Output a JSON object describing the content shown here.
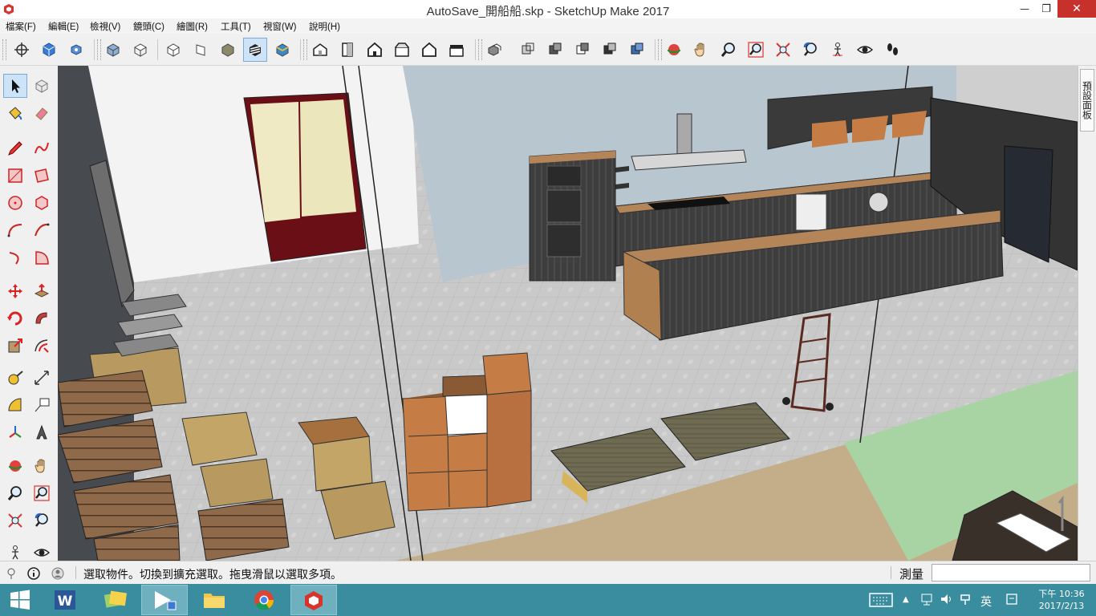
{
  "window": {
    "title": "AutoSave_開船船.skp - SketchUp Make 2017",
    "minimize_glyph": "—",
    "maximize_glyph": "❐",
    "close_glyph": "✕"
  },
  "menubar": {
    "items": [
      "檔案(F)",
      "編輯(E)",
      "檢視(V)",
      "鏡頭(C)",
      "繪圖(R)",
      "工具(T)",
      "視窗(W)",
      "說明(H)"
    ]
  },
  "toolbar": {
    "icons": [
      "orbit-target-icon",
      "component-icon",
      "group-icon",
      "iso-view-icon",
      "top-view-icon",
      "front-view-icon",
      "right-view-icon",
      "back-view-icon",
      "left-view-icon",
      "xray-icon",
      "wireframe-icon",
      "hidden-line-icon",
      "shaded-icon",
      "shaded-textures-icon",
      "monochrome-icon",
      "house-iso-icon",
      "house-top-icon",
      "house-front-icon",
      "house-right-icon",
      "house-back-icon",
      "house-left-icon",
      "outer-shell-icon",
      "intersect-icon",
      "union-icon",
      "subtract-icon",
      "trim-icon",
      "split-icon",
      "orbit-icon",
      "pan-icon",
      "zoom-icon",
      "zoom-window-icon",
      "zoom-extents-icon",
      "previous-view-icon",
      "position-camera-icon",
      "look-around-icon",
      "walk-icon"
    ],
    "active_icon": "shaded-textures-icon"
  },
  "lefttools": {
    "active_tool": "select-tool"
  },
  "tray": {
    "label": "預設面板"
  },
  "statusbar": {
    "text": "選取物件。切換到擴充選取。拖曳滑鼠以選取多項。",
    "measure_label": "測量",
    "measure_value": ""
  },
  "taskbar": {
    "apps": [
      "word",
      "photos",
      "media-player",
      "file-explorer",
      "chrome",
      "sketchup"
    ],
    "active_app": "sketchup",
    "ime_label": "英",
    "clock_time": "下午 10:36",
    "clock_date": "2017/2/13"
  },
  "colors": {
    "taskbar": "#3a8d9f",
    "toolbar_bg": "#f0f0f0",
    "floor": "#c9c9c9",
    "wall": "#b8c6cf",
    "wood": "#b5855a",
    "box": "#c57d45",
    "cabinet_dark": "#3c3c3c"
  }
}
